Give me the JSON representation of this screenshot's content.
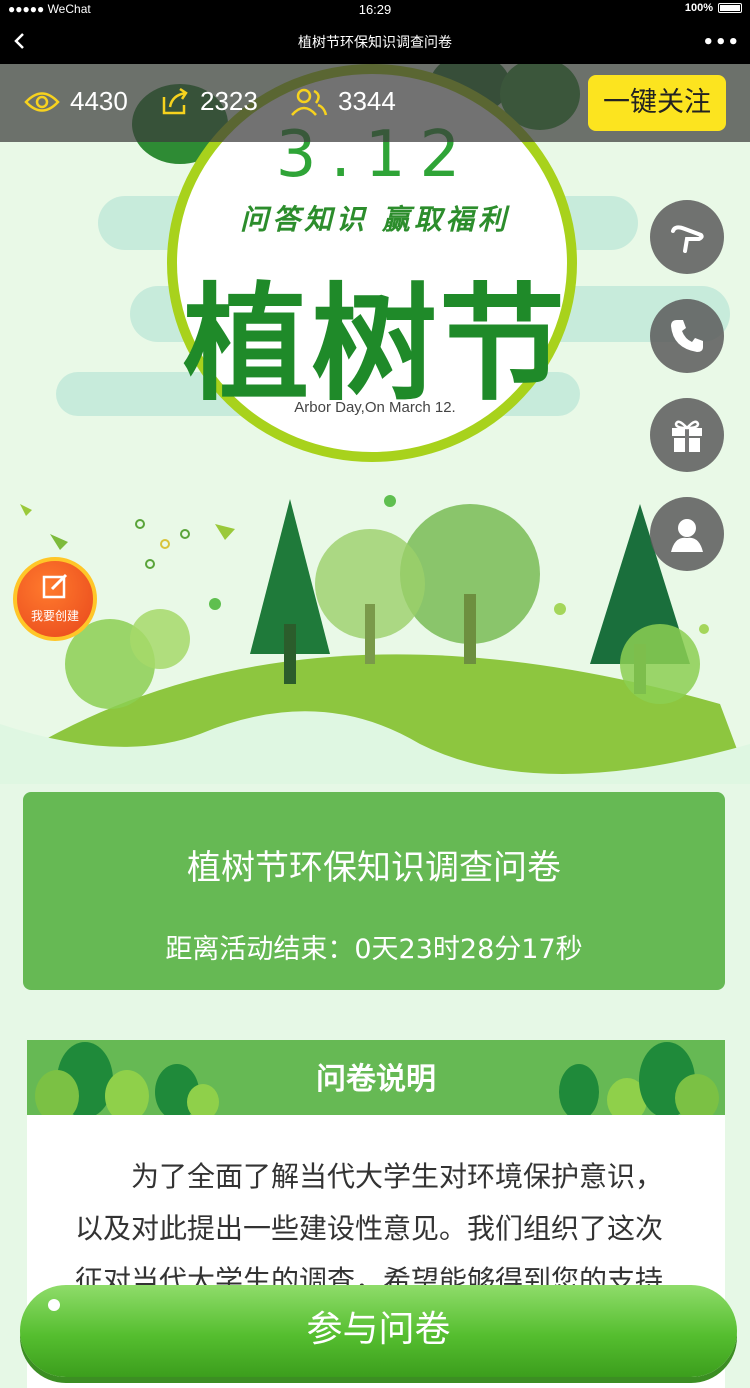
{
  "status_bar": {
    "carrier": "●●●●● WeChat",
    "time": "16:29",
    "battery": "100%"
  },
  "nav": {
    "title": "植树节环保知识调查问卷",
    "more": "•••"
  },
  "stats": {
    "views": "4430",
    "shares": "2323",
    "participants": "3344"
  },
  "follow_button": "一键关注",
  "hero": {
    "date": "3.12",
    "slogan": "问答知识 赢取福利",
    "title": "植树节",
    "subtitle_en": "Arbor  Day,On March 12."
  },
  "create_badge": "我要创建",
  "info_card": {
    "title": "植树节环保知识调查问卷",
    "countdown": "距离活动结束：0天23时28分17秒"
  },
  "description": {
    "heading": "问卷说明",
    "text": "为了全面了解当代大学生对环境保护意识，以及对此提出一些建设性意见。我们组织了这次征对当代大学生的调查，希望能够得到您的支持和..."
  },
  "join_button": "参与问卷",
  "colors": {
    "accent_green": "#66b954",
    "yellow": "#fce41f",
    "title_green": "#1f8a29"
  }
}
